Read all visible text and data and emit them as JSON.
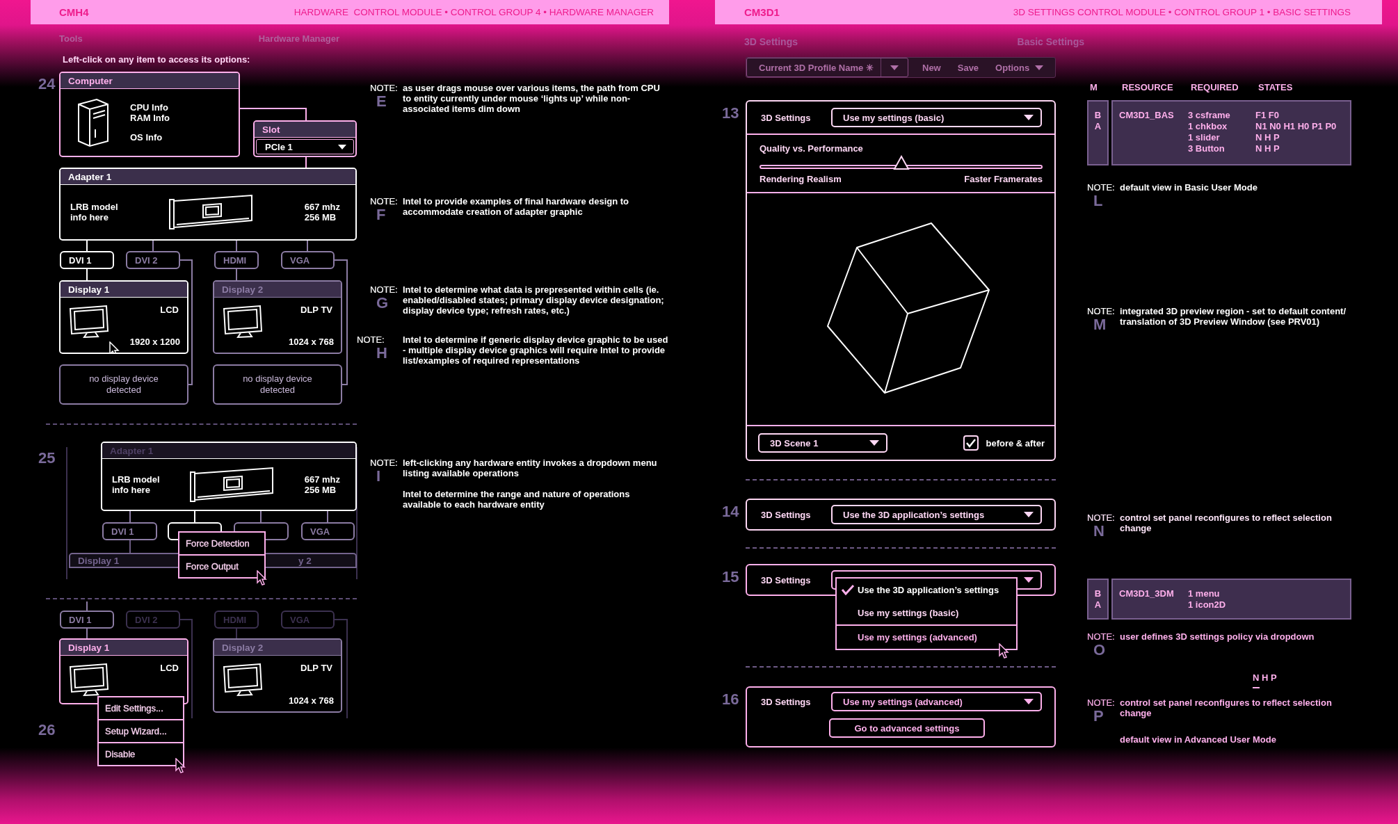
{
  "left_header": {
    "code": "CMH4",
    "title": "HARDWARE  CONTROL MODULE • CONTROL GROUP 4 • HARDWARE MANAGER"
  },
  "left_subnav": {
    "section": "Tools",
    "page": "Hardware Manager"
  },
  "instruction": "Left-click on any item to access its options:",
  "hardware_views": [
    {
      "number": "24",
      "computer": {
        "title": "Computer",
        "info": [
          "CPU Info",
          "RAM Info",
          "OS Info"
        ],
        "color": "#ffb0ec"
      },
      "slot": {
        "title": "Slot",
        "value": "PCIe 1",
        "color": "#ffb0ec"
      },
      "adapter": {
        "title": "Adapter 1",
        "model": [
          "LRB model",
          "info here"
        ],
        "specs": [
          "667 mhz",
          "256 MB"
        ],
        "color": "#ffffff",
        "title_dimmed": false
      },
      "ports": [
        {
          "label": "DVI 1",
          "color": "#ffffff"
        },
        {
          "label": "DVI 2",
          "color": "#8c7ca4"
        },
        {
          "label": "HDMI",
          "color": "#8c7ca4"
        },
        {
          "label": "VGA",
          "color": "#8c7ca4"
        }
      ],
      "displays": [
        {
          "title": "Display 1",
          "type": "LCD",
          "resolution": "1920 x 1200",
          "color": "#ffffff",
          "hovered": true
        },
        {
          "title": "Display 2",
          "type": "DLP TV",
          "resolution": "1024 x 768",
          "color": "#8c7ca4",
          "hovered": false
        }
      ],
      "empty_outputs": [
        {
          "text": "no display device detected",
          "color": "#8c7ca4"
        },
        {
          "text": "no display device detected",
          "color": "#8c7ca4"
        }
      ]
    },
    {
      "number": "25",
      "adapter": {
        "title": "Adapter 1",
        "model": [
          "LRB model",
          "info here"
        ],
        "specs": [
          "667 mhz",
          "256 MB"
        ],
        "color": "#ffffff",
        "title_dimmed": true
      },
      "ports": [
        {
          "label": "DVI 1",
          "color": "#8c7ca4"
        },
        {
          "color": "#ffffff"
        },
        {
          "color": "#8c7ca4"
        },
        {
          "label": "VGA",
          "color": "#8c7ca4"
        }
      ],
      "display_headers": [
        {
          "title": "Display 1",
          "color": "#74648e"
        },
        {
          "title": "y 2",
          "color": "#74648e"
        }
      ],
      "menu": [
        {
          "label": "Force Detection",
          "hovered": false
        },
        {
          "label": "Force Output",
          "hovered": true
        }
      ]
    },
    {
      "number": "26",
      "ports": [
        {
          "label": "DVI 1",
          "color": "#8c7ca4"
        },
        {
          "label": "DVI 2",
          "color": "#3c3150"
        },
        {
          "label": "HDMI",
          "color": "#3c3150"
        },
        {
          "label": "VGA",
          "color": "#3c3150"
        }
      ],
      "displays": [
        {
          "title": "Display 1",
          "type": "LCD",
          "color": "#ffb0ec",
          "hovered": false
        },
        {
          "title": "Display 2",
          "type": "DLP TV",
          "resolution": "1024 x 768",
          "color": "#8c7ca4",
          "hovered": false
        }
      ],
      "menu": [
        {
          "label": "Edit Settings...",
          "hovered": false
        },
        {
          "label": "Setup Wizard...",
          "hovered": false
        },
        {
          "label": "Disable",
          "hovered": true
        }
      ]
    }
  ],
  "left_notes": [
    {
      "label": "NOTE:",
      "letter": "E",
      "paragraphs": [
        "as user drags mouse over various items, the path from CPU to entity currently under mouse ‘lights up’ while non-associated items dim down"
      ]
    },
    {
      "label": "NOTE:",
      "letter": "F",
      "paragraphs": [
        "Intel to provide examples of final hardware design to accommodate creation of adapter graphic"
      ]
    },
    {
      "label": "NOTE:",
      "letter": "G",
      "paragraphs": [
        "Intel to determine what data is prepresented within cells (ie. enabled/disabled states; primary display device designation; display device type; refresh rates, etc.)"
      ]
    },
    {
      "label": "NOTE:",
      "letter": "H",
      "paragraphs": [
        "Intel to determine if generic display device graphic to be used - multiple display device graphics will require Intel to provide list/examples of required representations"
      ]
    },
    {
      "label": "NOTE:",
      "letter": "I",
      "paragraphs": [
        "left-clicking any hardware entity invokes a dropdown menu listing available operations",
        "Intel to determine the range and nature of operations available to each hardware entity"
      ]
    }
  ],
  "right_header": {
    "code": "CM3D1",
    "title": "3D SETTINGS CONTROL MODULE • CONTROL GROUP 1 • BASIC SETTINGS"
  },
  "right_subnav": {
    "section": "3D Settings",
    "page": "Basic Settings"
  },
  "toolbar": {
    "profile": "Current 3D Profile Name ✳",
    "buttons": [
      {
        "label": "New",
        "has_menu": false
      },
      {
        "label": "Save",
        "has_menu": false
      },
      {
        "label": "Options",
        "has_menu": true
      }
    ]
  },
  "panels": [
    {
      "number": "13",
      "kind": "basic",
      "label": "3D Settings",
      "dropdown": "Use my settings (basic)",
      "slider": {
        "title": "Quality vs. Performance",
        "level": 0.5,
        "min_label": "Rendering Realism",
        "max_label": "Faster Framerates"
      },
      "scene_dropdown": "3D Scene 1",
      "checkbox": {
        "label": "before & after",
        "checked": true
      }
    },
    {
      "number": "14",
      "kind": "compact",
      "label": "3D Settings",
      "dropdown": "Use the 3D application’s settings"
    },
    {
      "number": "15",
      "kind": "open_menu",
      "label": "3D Settings",
      "menu": [
        {
          "label": "Use the 3D application’s settings",
          "selected": true,
          "hovered": false
        },
        {
          "label": "Use my settings (basic)",
          "selected": false,
          "hovered": false
        },
        {
          "label": "Use my settings (advanced)",
          "selected": false,
          "hovered": true
        }
      ]
    },
    {
      "number": "16",
      "kind": "advanced",
      "label": "3D Settings",
      "dropdown": "Use my settings (advanced)",
      "button": "Go to advanced settings"
    }
  ],
  "annotations": [
    {
      "kind": "table_header",
      "columns": [
        "M",
        "RESOURCE",
        "REQUIRED",
        "STATES"
      ]
    },
    {
      "kind": "resource",
      "modes": [
        "B",
        "A"
      ],
      "resource": "CM3D1_BAS",
      "required": [
        "3 csframe",
        "1 chkbox",
        "1 slider",
        "3 Button"
      ],
      "states": [
        "F1 F0",
        "N1 N0 H1 H0 P1 P0",
        "N H P",
        "N H P"
      ]
    },
    {
      "kind": "note",
      "label": "NOTE:",
      "letter": "L",
      "color": "#ffffff",
      "paragraphs": [
        "default view in Basic User Mode"
      ]
    },
    {
      "kind": "note",
      "label": "NOTE:",
      "letter": "M",
      "color": "#ffffff",
      "paragraphs": [
        "integrated 3D preview region - set to default content/ translation of 3D Preview Window (see PRV01)"
      ]
    },
    {
      "kind": "note",
      "label": "NOTE:",
      "letter": "N",
      "color": "#ffe6fa",
      "paragraphs": [
        "control set panel reconfigures to reflect selection change"
      ]
    },
    {
      "kind": "resource",
      "modes": [
        "B",
        "A"
      ],
      "resource": "CM3D1_3DM",
      "required": [
        "1 menu",
        "1 icon2D"
      ]
    },
    {
      "kind": "note",
      "label": "NOTE:",
      "letter": "O",
      "color": "#ffb0ec",
      "paragraphs": [
        "user defines 3D settings policy via dropdown"
      ]
    },
    {
      "kind": "states",
      "text": "N H P"
    },
    {
      "kind": "note",
      "label": "NOTE:",
      "letter": "P",
      "color": "#ffb0ec",
      "paragraphs": [
        "control set panel reconfigures to reflect selection change",
        "default view in Advanced User Mode"
      ]
    }
  ]
}
